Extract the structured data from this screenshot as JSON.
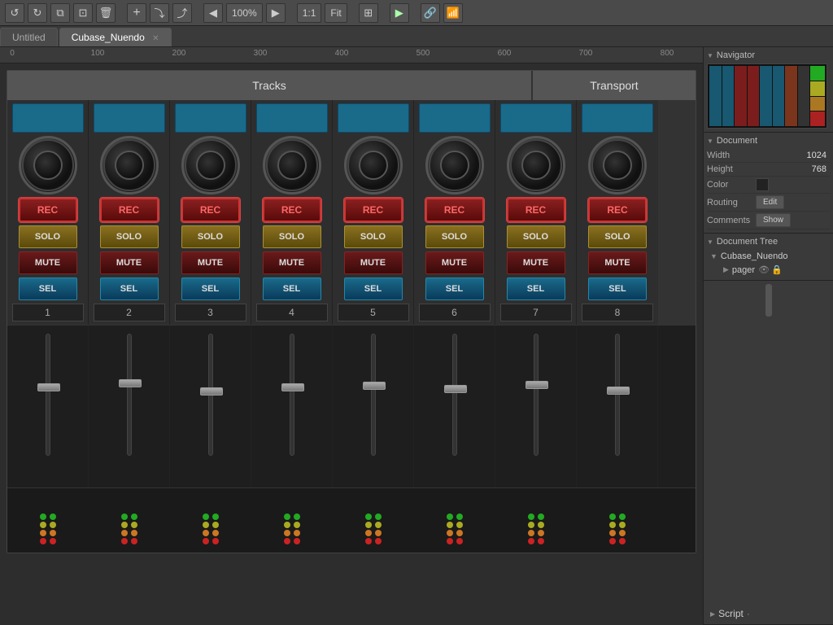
{
  "toolbar": {
    "undo": "↺",
    "redo": "↻",
    "copy": "⧉",
    "paste": "⊡",
    "delete": "⬜",
    "add": "+",
    "import": "⤵",
    "export": "⤴",
    "prev": "◀",
    "zoom_value": "100%",
    "next": "▶",
    "ratio": "1:1",
    "fit": "Fit",
    "grid": "⊞",
    "play": "▶",
    "link": "🔗",
    "wifi": "📶"
  },
  "tabs": [
    {
      "label": "Untitled",
      "active": false,
      "closable": false
    },
    {
      "label": "Cubase_Nuendo",
      "active": true,
      "closable": true
    }
  ],
  "ruler": {
    "marks": [
      0,
      100,
      200,
      300,
      400,
      500,
      600,
      700,
      800
    ]
  },
  "mixer": {
    "tracks_label": "Tracks",
    "transport_label": "Transport",
    "channels": [
      {
        "num": "1"
      },
      {
        "num": "2"
      },
      {
        "num": "3"
      },
      {
        "num": "4"
      },
      {
        "num": "5"
      },
      {
        "num": "6"
      },
      {
        "num": "7"
      },
      {
        "num": "8"
      }
    ],
    "rec_label": "REC",
    "solo_label": "SOLO",
    "mute_label": "MUTE",
    "sel_label": "SEL"
  },
  "navigator": {
    "title": "Navigator"
  },
  "document": {
    "title": "Document",
    "width_label": "Width",
    "width_value": "1024",
    "height_label": "Height",
    "height_value": "768",
    "color_label": "Color",
    "routing_label": "Routing",
    "routing_btn": "Edit",
    "comments_label": "Comments",
    "comments_btn": "Show"
  },
  "document_tree": {
    "title": "Document Tree",
    "root": "Cubase_Nuendo",
    "children": [
      {
        "label": "pager",
        "has_children": true
      }
    ]
  },
  "script": {
    "label": "Script"
  }
}
